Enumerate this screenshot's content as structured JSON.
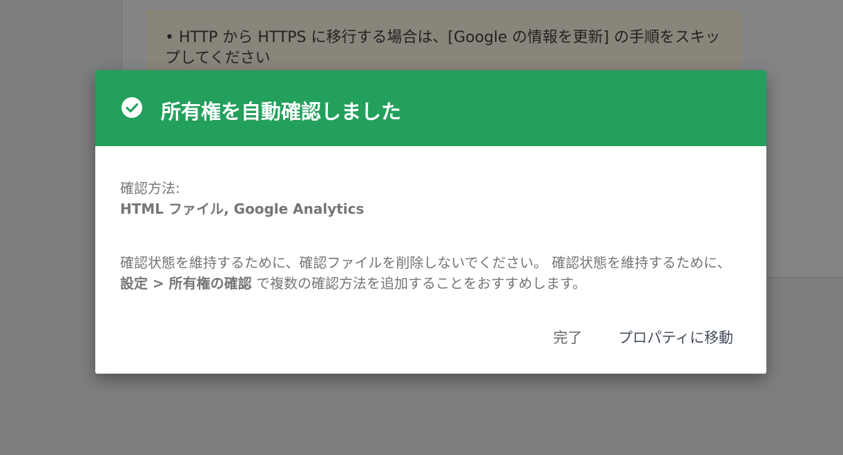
{
  "background": {
    "notice_text": "• HTTP から HTTPS に移行する場合は、[Google の情報を更新] の手順をスキップしてください"
  },
  "dialog": {
    "header_color": "#23a05c",
    "icon": "check-circle-icon",
    "title": "所有権を自動確認しました",
    "method_label": "確認方法:",
    "method_value": "HTML ファイル, Google Analytics",
    "message_part1": "確認状態を維持するために、確認ファイルを削除しないでください。 確認状態を維持するために、",
    "message_bold": "設定 > 所有権の確認",
    "message_part2": " で複数の確認方法を追加することをおすすめします。",
    "actions": {
      "done_label": "完了",
      "goto_label": "プロパティに移動"
    }
  }
}
